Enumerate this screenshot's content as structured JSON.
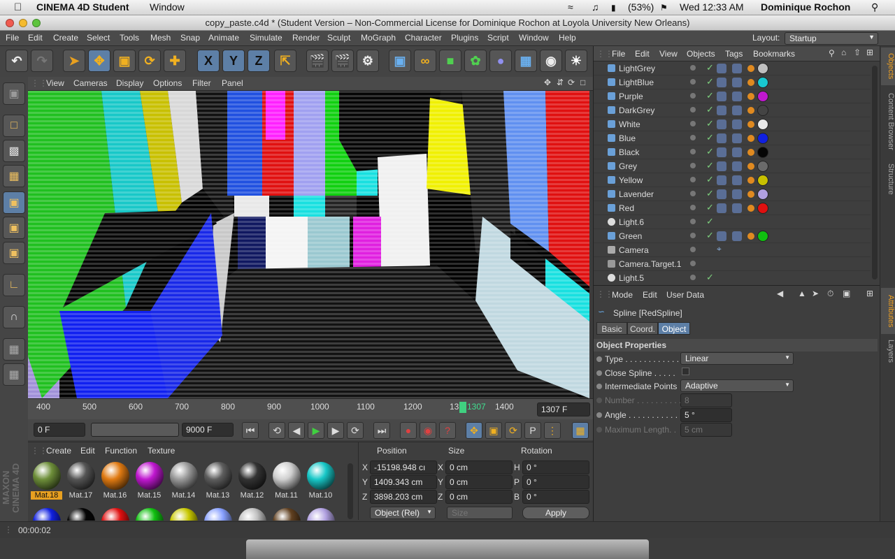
{
  "macbar": {
    "app": "CINEMA 4D Student",
    "menu1": "Window",
    "battery": "(53%)",
    "clock": "Wed 12:33 AM",
    "user": "Dominique Rochon"
  },
  "window": {
    "title": "copy_paste.c4d * (Student Version – Non-Commercial License for Dominique Rochon at Loyola University New Orleans)"
  },
  "menus": [
    "File",
    "Edit",
    "Create",
    "Select",
    "Tools",
    "Mesh",
    "Snap",
    "Animate",
    "Simulate",
    "Render",
    "Sculpt",
    "MoGraph",
    "Character",
    "Plugins",
    "Script",
    "Window",
    "Help"
  ],
  "layout": {
    "label": "Layout:",
    "value": "Startup"
  },
  "toolbar": {
    "x": "X",
    "y": "Y",
    "z": "Z"
  },
  "viewport_menu": [
    "View",
    "Cameras",
    "Display",
    "Options",
    "Filter",
    "Panel"
  ],
  "timeline": {
    "ticks": [
      "400",
      "500",
      "600",
      "700",
      "800",
      "900",
      "1000",
      "1100",
      "1200",
      "13",
      "1400"
    ],
    "marker": "1307",
    "frame_field": "1307 F"
  },
  "playbar": {
    "start": "0 F",
    "end": "9000 F"
  },
  "materials": {
    "menu": [
      "Create",
      "Edit",
      "Function",
      "Texture"
    ],
    "items": [
      {
        "name": "Mat.18",
        "color": "#6e8f3a"
      },
      {
        "name": "Mat.17",
        "color": "#555555"
      },
      {
        "name": "Mat.16",
        "color": "#e07a12"
      },
      {
        "name": "Mat.15",
        "color": "#c018d0"
      },
      {
        "name": "Mat.14",
        "color": "#9a9a9a"
      },
      {
        "name": "Mat.13",
        "color": "#5e5e5e"
      },
      {
        "name": "Mat.12",
        "color": "#333333"
      },
      {
        "name": "Mat.11",
        "color": "#d0d0d0"
      },
      {
        "name": "Mat.10",
        "color": "#18c8c8"
      }
    ],
    "row2": [
      "#1020e0",
      "#050505",
      "#e01010",
      "#10c010",
      "#c8c800",
      "#88a0ff",
      "#c0c0c0",
      "#604020",
      "#b0a0e0"
    ]
  },
  "coords": {
    "headers": [
      "Position",
      "Size",
      "Rotation"
    ],
    "rows": [
      {
        "axis": "X",
        "pos": "-15198.948 cı",
        "sl": "X",
        "size": "0 cm",
        "rl": "H",
        "rot": "0 °"
      },
      {
        "axis": "Y",
        "pos": "1409.343 cm",
        "sl": "Y",
        "size": "0 cm",
        "rl": "P",
        "rot": "0 °"
      },
      {
        "axis": "Z",
        "pos": "3898.203 cm",
        "sl": "Z",
        "size": "0 cm",
        "rl": "B",
        "rot": "0 °"
      }
    ],
    "mode": "Object (Rel)",
    "size_mode": "Size",
    "apply": "Apply"
  },
  "status": {
    "time": "00:00:02"
  },
  "objects": {
    "menu": [
      "File",
      "Edit",
      "View",
      "Objects",
      "Tags",
      "Bookmarks"
    ],
    "items": [
      {
        "name": "LightGrey",
        "tag": "#bfbfbf",
        "type": "mesh"
      },
      {
        "name": "LightBlue",
        "tag": "#18c8d0",
        "type": "mesh"
      },
      {
        "name": "Purple",
        "tag": "#c018d0",
        "type": "mesh"
      },
      {
        "name": "DarkGrey",
        "tag": "#444444",
        "type": "mesh"
      },
      {
        "name": "White",
        "tag": "#e8e8e8",
        "type": "mesh"
      },
      {
        "name": "Blue",
        "tag": "#1020e0",
        "type": "mesh"
      },
      {
        "name": "Black",
        "tag": "#050505",
        "type": "mesh"
      },
      {
        "name": "Grey",
        "tag": "#6a6a6a",
        "type": "mesh"
      },
      {
        "name": "Yellow",
        "tag": "#c8c000",
        "type": "mesh"
      },
      {
        "name": "Lavender",
        "tag": "#b0a0e0",
        "type": "mesh"
      },
      {
        "name": "Red",
        "tag": "#e01010",
        "type": "mesh"
      },
      {
        "name": "Light.6",
        "tag": "",
        "type": "light"
      },
      {
        "name": "Green",
        "tag": "#10c010",
        "type": "mesh"
      },
      {
        "name": "Camera",
        "tag": "",
        "type": "camera"
      },
      {
        "name": "Camera.Target.1",
        "tag": "",
        "type": "null"
      },
      {
        "name": "Light.5",
        "tag": "",
        "type": "light"
      }
    ]
  },
  "side_tabs": [
    "Objects",
    "Content Browser",
    "Structure",
    "Attributes",
    "Layers"
  ],
  "attributes": {
    "menu": [
      "Mode",
      "Edit",
      "User Data"
    ],
    "title": "Spline [RedSpline]",
    "tabs": [
      "Basic",
      "Coord.",
      "Object"
    ],
    "section": "Object Properties",
    "props": [
      {
        "label": "Type . . . . . . . . . . . .",
        "value": "Linear"
      },
      {
        "label": "Close Spline . . . . .",
        "value": ""
      },
      {
        "label": "Intermediate Points",
        "value": "Adaptive"
      },
      {
        "label": "Number . . . . . . . . . .",
        "value": "8"
      },
      {
        "label": "Angle . . . . . . . . . . .",
        "value": "5 °"
      },
      {
        "label": "Maximum Length. .",
        "value": "5 cm"
      }
    ]
  }
}
